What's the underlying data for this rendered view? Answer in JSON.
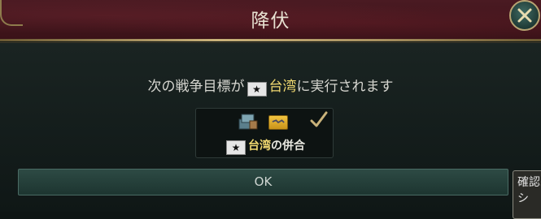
{
  "dialog": {
    "title": "降伏",
    "message_before": "次の戦争目標が",
    "message_country": "台湾",
    "message_after": "に実行されます",
    "flag_glyph": "★"
  },
  "goal": {
    "icons": [
      "cargo-crate-icon",
      "ticket-icon",
      "checkmark-icon"
    ],
    "country": "台湾",
    "label_after": "の併合"
  },
  "ok_label": "OK",
  "side_panel": {
    "line1": "確認",
    "line2": "シ"
  },
  "colors": {
    "header": "#4a1a22",
    "gold_text": "#f0d870",
    "border_gold": "#c9b27a",
    "button": "#2d4a44"
  }
}
